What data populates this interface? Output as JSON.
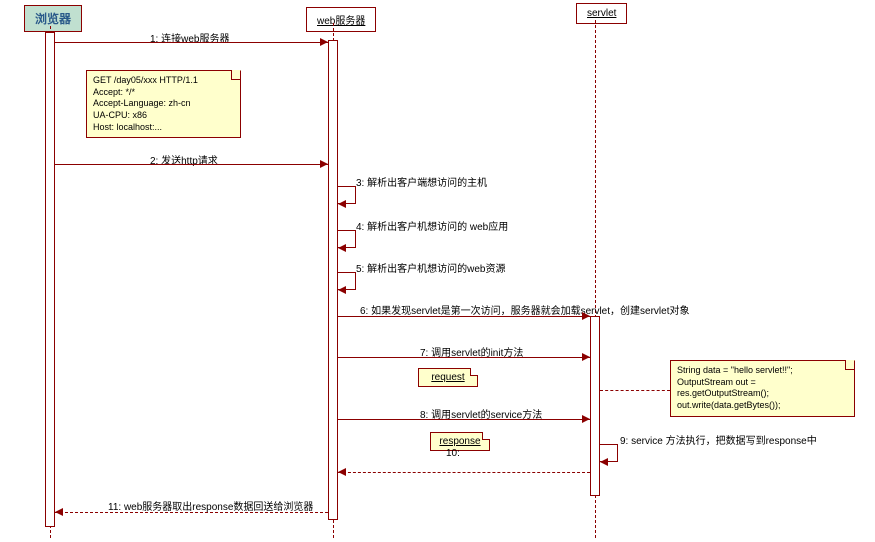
{
  "actors": {
    "browser": "浏览器",
    "webserver": "web服务器",
    "servlet": "servlet"
  },
  "messages": {
    "m1": "1: 连接web服务器",
    "m2": "2: 发送http请求",
    "m3": "3: 解析出客户端想访问的主机",
    "m4": "4: 解析出客户机想访问的 web应用",
    "m5": "5: 解析出客户机想访问的web资源",
    "m6": "6: 如果发现servlet是第一次访问，服务器就会加载servlet，创建servlet对象",
    "m7": "7: 调用servlet的init方法",
    "m8": "8: 调用servlet的service方法",
    "m9": "9: service 方法执行，把数据写到response中",
    "m10": "10:",
    "m11": "11: web服务器取出response数据回送给浏览器"
  },
  "objects": {
    "request": "request",
    "response": "response"
  },
  "notes": {
    "http": {
      "l1": "GET /day05/xxx HTTP/1.1",
      "l2": "Accept: */*",
      "l3": "Accept-Language: zh-cn",
      "l4": "UA-CPU: x86",
      "l5": "Host: localhost:..."
    },
    "code": {
      "l1": "String data = \"hello servlet!!\";",
      "l2": "OutputStream out = res.getOutputStream();",
      "l3": "out.write(data.getBytes());"
    }
  }
}
